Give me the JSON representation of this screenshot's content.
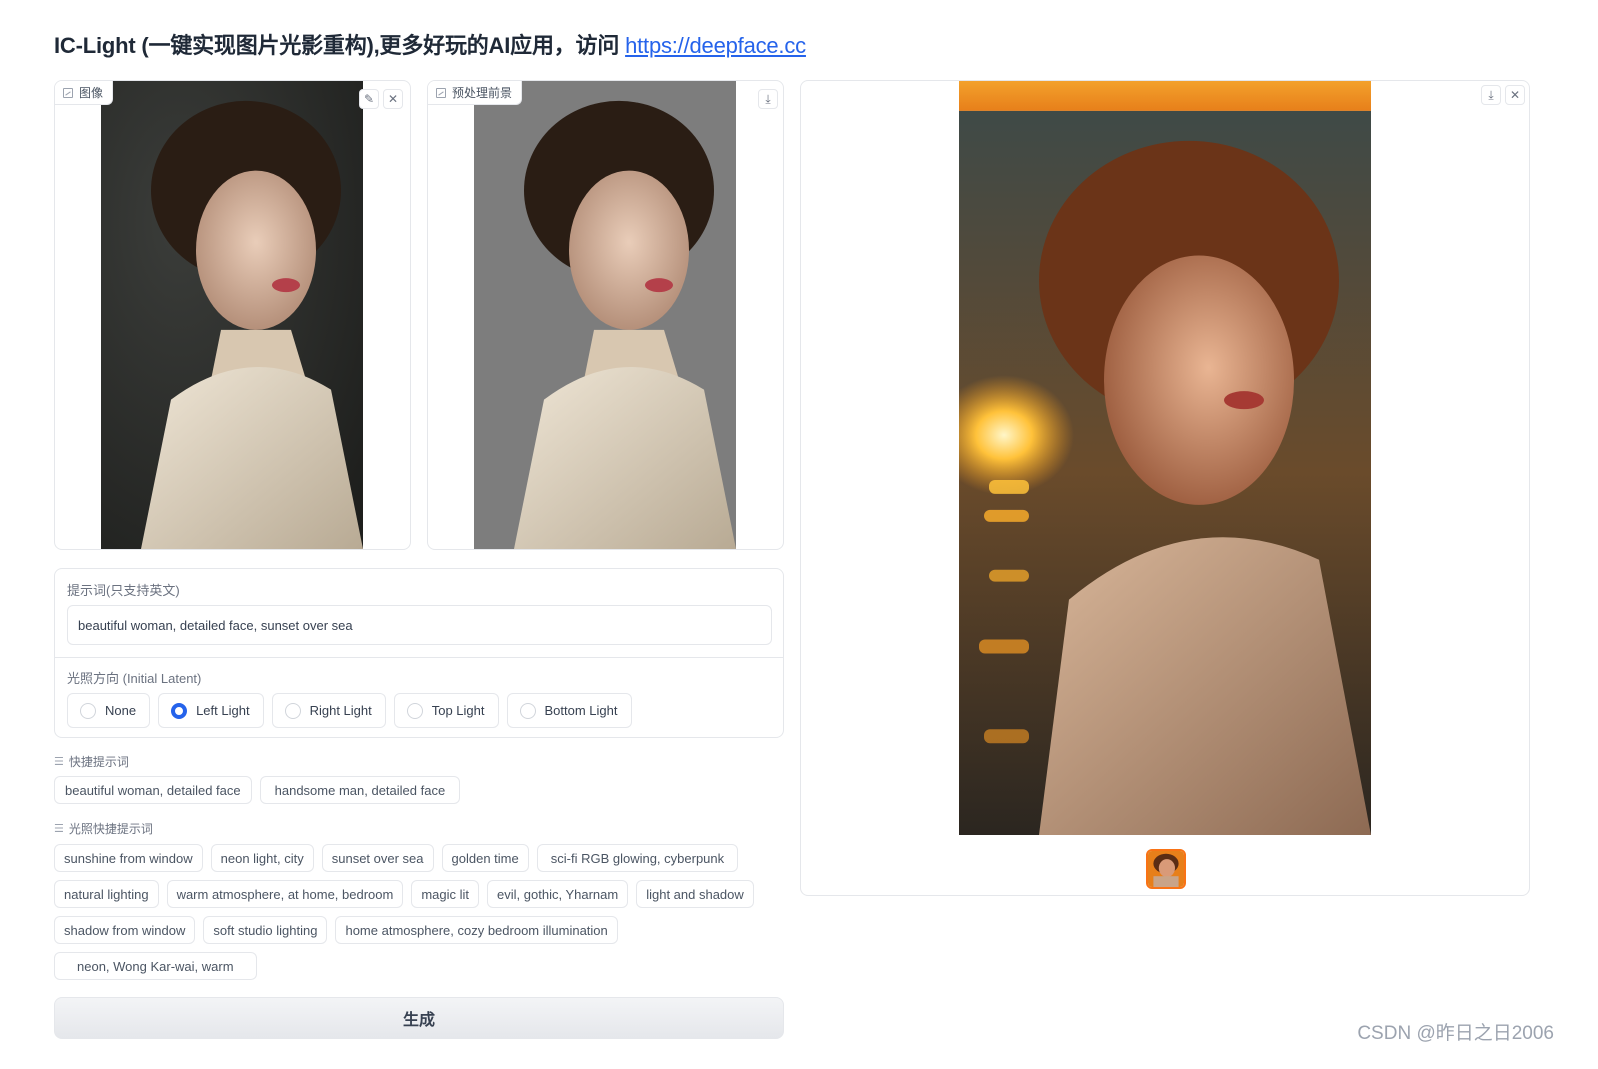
{
  "header": {
    "title_prefix": "IC-Light (一键实现图片光影重构),更多好玩的AI应用，访问 ",
    "link_text": "https://deepface.cc"
  },
  "input_image": {
    "label": "图像",
    "edit_icon": "pencil-icon",
    "clear_icon": "close-icon"
  },
  "preprocessed_image": {
    "label": "预处理前景",
    "download_icon": "download-icon"
  },
  "prompt": {
    "label": "提示词(只支持英文)",
    "value": "beautiful woman, detailed face, sunset over sea"
  },
  "light_direction": {
    "label": "光照方向 (Initial Latent)",
    "options": [
      "None",
      "Left Light",
      "Right Light",
      "Top Light",
      "Bottom Light"
    ],
    "selected": "Left Light"
  },
  "quick_prompts": {
    "label": "快捷提示词",
    "items": [
      "beautiful woman, detailed face",
      "handsome man, detailed face"
    ]
  },
  "lighting_prompts": {
    "label": "光照快捷提示词",
    "items": [
      "sunshine from window",
      "neon light, city",
      "sunset over sea",
      "golden time",
      "sci-fi RGB glowing, cyberpunk",
      "natural lighting",
      "warm atmosphere, at home, bedroom",
      "magic lit",
      "evil, gothic, Yharnam",
      "light and shadow",
      "shadow from window",
      "soft studio lighting",
      "home atmosphere, cozy bedroom illumination",
      "neon, Wong Kar-wai, warm"
    ]
  },
  "generate_button": {
    "label": "生成"
  },
  "output_gallery": {
    "download_icon": "download-icon",
    "clear_icon": "close-icon",
    "thumbnail_count": 1
  },
  "watermark": "CSDN @昨日之日2006",
  "colors": {
    "accent": "#2563eb",
    "link": "#2563eb",
    "thumbnail_border": "#f97316"
  }
}
